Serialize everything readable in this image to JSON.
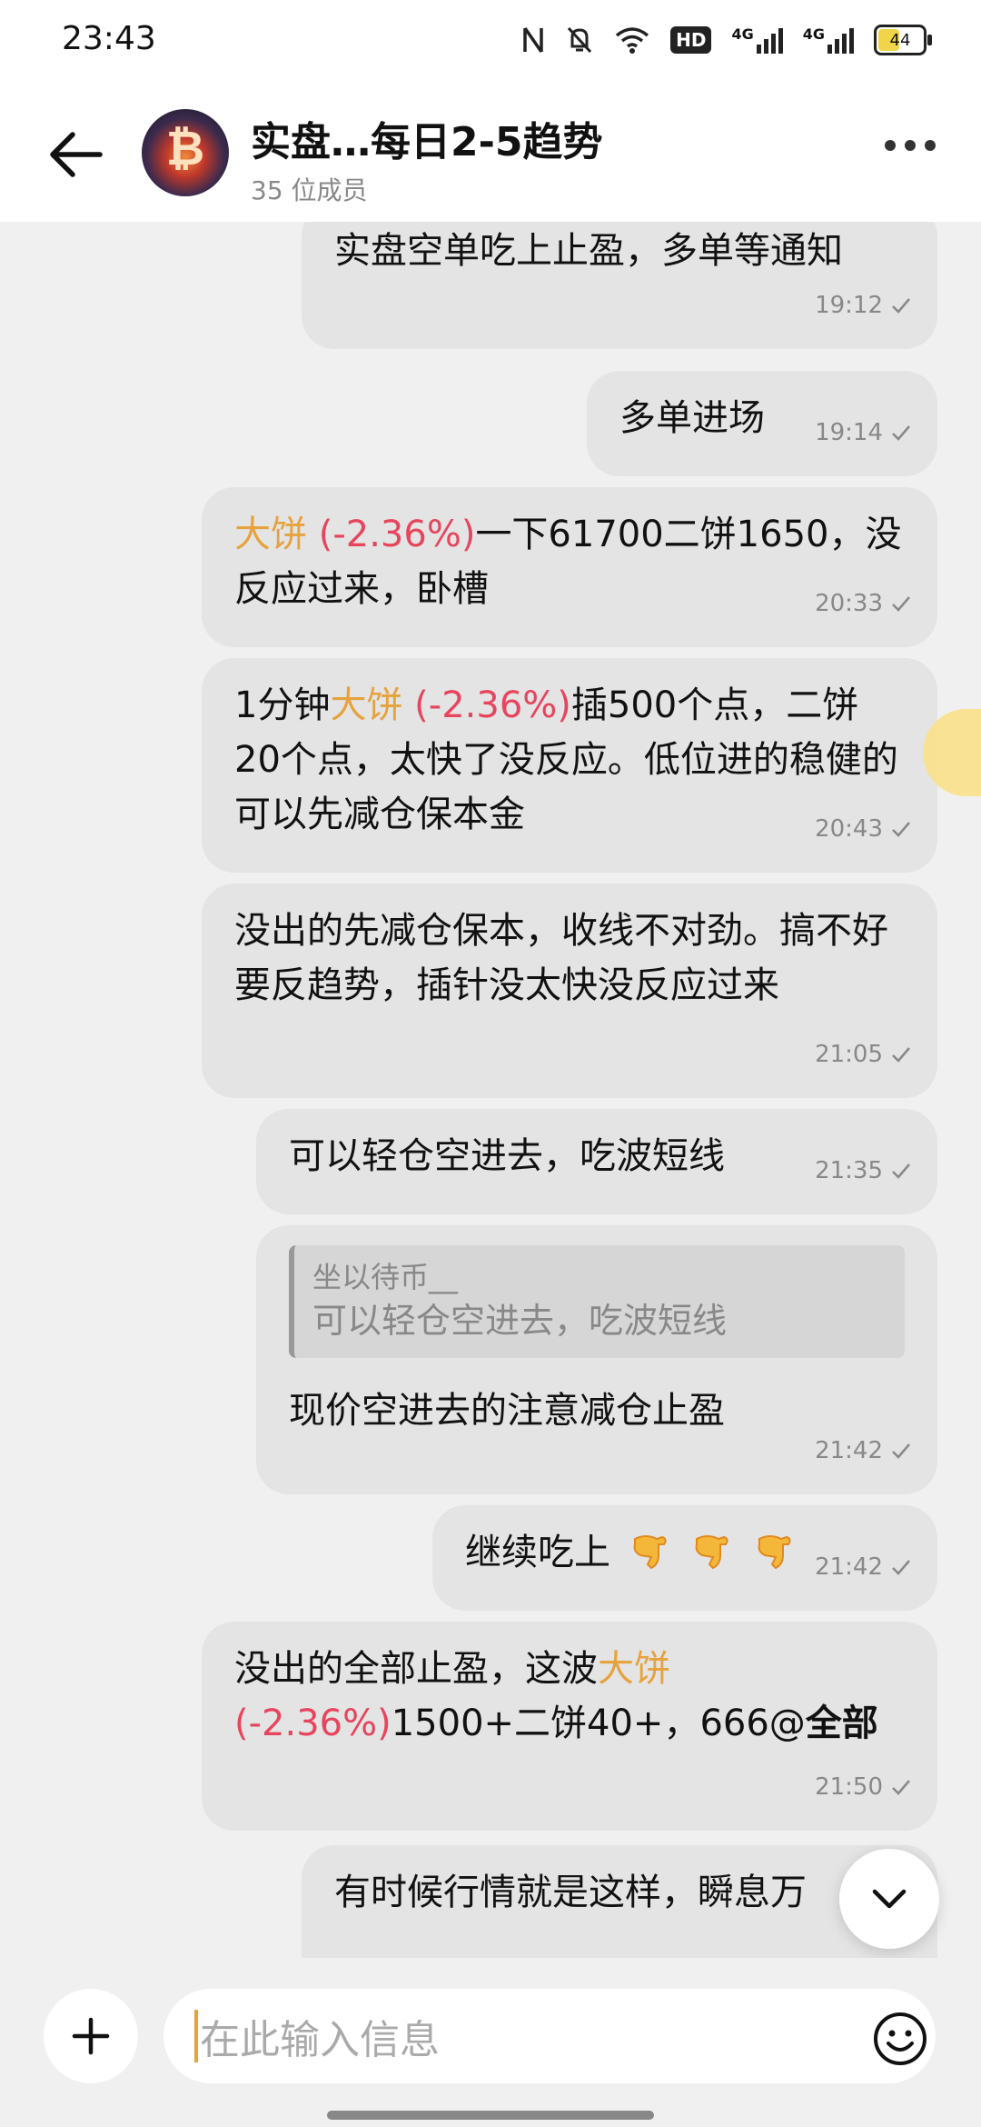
{
  "status_bar": {
    "time": "23:43",
    "battery": "44",
    "network_badge": "HD",
    "signal1": "4G",
    "signal2": "4G"
  },
  "header": {
    "title": "实盘…每日2-5趋势",
    "members": "35 位成员"
  },
  "messages": [
    {
      "text": "实盘空单吃上止盈，多单等通知",
      "time": "19:12"
    },
    {
      "text": "多单进场",
      "time": "19:14"
    },
    {
      "tag": "大饼",
      "pct": " (-2.36%)",
      "rest": "一下61700二饼1650，没反应过来，卧槽",
      "time": "20:33"
    },
    {
      "pre": "1分钟",
      "tag": "大饼",
      "pct": " (-2.36%)",
      "rest": "插500个点，二饼20个点，太快了没反应。低位进的稳健的可以先减仓保本金",
      "time": "20:43"
    },
    {
      "text": "没出的先减仓保本，收线不对劲。搞不好要反趋势，插针没太快没反应过来",
      "time": "21:05"
    },
    {
      "text": "可以轻仓空进去，吃波短线",
      "time": "21:35"
    },
    {
      "quote_name": "坐以待币__",
      "quote_text": "可以轻仓空进去，吃波短线",
      "text": "现价空进去的注意减仓止盈",
      "time": "21:42"
    },
    {
      "text": "继续吃上",
      "time": "21:42"
    },
    {
      "pre": "没出的全部止盈，这波",
      "tag": "大饼",
      "pct": "(-2.36%)",
      "rest": "1500+二饼40+，666@",
      "bold": "全部",
      "time": "21:50"
    },
    {
      "text": "有时候行情就是这样，瞬息万"
    }
  ],
  "input": {
    "placeholder": "在此输入信息"
  },
  "colors": {
    "tag": "#e6a23c",
    "negative": "#e6455d",
    "bubble": "#e4e4e4"
  }
}
